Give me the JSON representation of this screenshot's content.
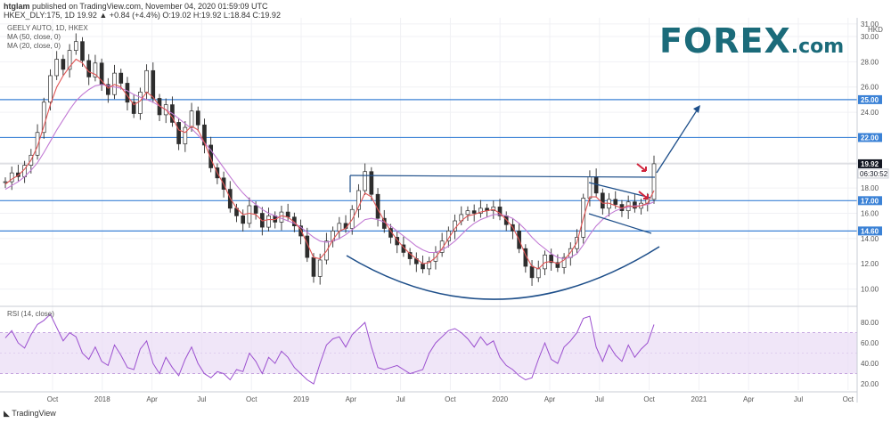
{
  "header": {
    "publisher": "htglam",
    "published_text": "published on TradingView.com, November 04, 2020 01:59:09 UTC",
    "symbol_line": "HKEX_DLY:175, 1D  19.92  ▲ +0.84 (+4.4%)  O:19.02  H:19.92  L:18.84  C:19.92"
  },
  "logo": {
    "text": "FOREX",
    "suffix": ".com",
    "color": "#1b6b7a"
  },
  "footer": {
    "brand": "TradingView"
  },
  "colors": {
    "candle": "#2d2d2d",
    "ma50": "#c27ad4",
    "ma20": "#e05555",
    "level": "#3b82d6",
    "trend": "#1e4f8a",
    "rsi": "#9b4fcf",
    "rsi_band": "#e9dcf5",
    "arrow_red": "#d0233b"
  },
  "chart_data": [
    {
      "type": "candlestick",
      "title": "GEELY AUTO, 1D, HKEX",
      "legend": [
        "MA (50, close, 0)",
        "MA (20, close, 0)"
      ],
      "currency": "HKD",
      "x_axis_labels": [
        "Oct",
        "2018",
        "Apr",
        "Jul",
        "Oct",
        "2019",
        "Apr",
        "Jul",
        "Oct",
        "2020",
        "Apr",
        "Jul",
        "Oct",
        "2021",
        "Apr",
        "Jul",
        "Oct"
      ],
      "y_ticks": [
        10.0,
        12.0,
        14.0,
        16.0,
        18.0,
        20.0,
        22.0,
        24.0,
        26.0,
        28.0,
        30.0,
        31.0
      ],
      "ylim": [
        8.7,
        31.2
      ],
      "horizontal_levels": [
        25.0,
        22.0,
        17.0,
        14.6
      ],
      "last_price": 19.92,
      "countdown": "06:30:52",
      "close_series": [
        18.5,
        19.2,
        18.9,
        19.8,
        20.6,
        22.4,
        24.8,
        26.9,
        28.2,
        27.4,
        28.9,
        29.6,
        28.1,
        26.8,
        27.9,
        26.2,
        25.4,
        27.1,
        26.3,
        24.8,
        23.9,
        25.6,
        27.3,
        25.1,
        23.8,
        24.6,
        23.2,
        21.5,
        22.8,
        24.1,
        23.0,
        21.4,
        19.6,
        18.8,
        17.9,
        16.4,
        15.8,
        15.2,
        16.6,
        16.0,
        14.9,
        15.8,
        15.3,
        16.1,
        15.7,
        15.0,
        14.2,
        12.5,
        11.0,
        12.3,
        13.8,
        14.6,
        15.2,
        14.8,
        16.3,
        17.8,
        19.3,
        17.5,
        15.6,
        14.8,
        14.1,
        13.5,
        12.9,
        12.4,
        12.0,
        11.6,
        12.2,
        12.9,
        13.8,
        14.6,
        15.4,
        15.9,
        16.2,
        16.0,
        16.4,
        16.2,
        16.5,
        15.8,
        15.1,
        14.6,
        13.2,
        11.8,
        10.9,
        11.6,
        12.7,
        12.1,
        11.7,
        12.5,
        13.2,
        14.1,
        17.2,
        18.9,
        17.6,
        16.4,
        17.1,
        16.7,
        16.2,
        16.9,
        16.4,
        16.8,
        17.1,
        19.92
      ],
      "series": [
        {
          "name": "MA (50, close, 0)",
          "values": [
            17.9,
            18.2,
            18.5,
            18.9,
            19.4,
            20.0,
            20.8,
            21.7,
            22.6,
            23.4,
            24.2,
            24.9,
            25.4,
            25.8,
            26.1,
            26.2,
            26.1,
            26.0,
            25.9,
            25.7,
            25.4,
            25.2,
            25.0,
            24.8,
            24.5,
            24.2,
            23.9,
            23.5,
            23.1,
            22.7,
            22.2,
            21.6,
            21.0,
            20.3,
            19.6,
            18.9,
            18.2,
            17.6,
            17.1,
            16.7,
            16.3,
            16.0,
            15.8,
            15.6,
            15.4,
            15.2,
            14.9,
            14.5,
            14.1,
            13.8,
            13.7,
            13.8,
            14.0,
            14.3,
            14.7,
            15.1,
            15.5,
            15.6,
            15.5,
            15.3,
            15.0,
            14.6,
            14.2,
            13.8,
            13.4,
            13.1,
            12.9,
            12.9,
            13.1,
            13.4,
            13.8,
            14.3,
            14.8,
            15.2,
            15.5,
            15.7,
            15.9,
            15.9,
            15.8,
            15.6,
            15.2,
            14.7,
            14.1,
            13.6,
            13.2,
            12.8,
            12.5,
            12.4,
            12.5,
            12.8,
            13.5,
            14.3,
            15.0,
            15.5,
            15.9,
            16.2,
            16.4,
            16.5,
            16.6,
            16.6,
            16.7,
            16.9
          ]
        },
        {
          "name": "MA (20, close, 0)",
          "values": [
            18.3,
            18.7,
            19.0,
            19.5,
            20.2,
            21.3,
            22.9,
            24.6,
            26.0,
            26.9,
            27.6,
            28.2,
            27.9,
            27.2,
            27.0,
            26.5,
            25.9,
            26.2,
            26.0,
            25.3,
            24.6,
            24.9,
            25.6,
            25.2,
            24.5,
            24.2,
            23.6,
            22.6,
            22.4,
            22.9,
            22.6,
            21.6,
            20.3,
            19.2,
            18.3,
            17.2,
            16.4,
            15.9,
            16.0,
            15.9,
            15.4,
            15.5,
            15.5,
            15.8,
            15.7,
            15.3,
            14.7,
            13.6,
            12.5,
            12.4,
            13.0,
            13.9,
            14.6,
            14.8,
            15.5,
            16.5,
            17.6,
            17.3,
            16.3,
            15.4,
            14.6,
            13.9,
            13.3,
            12.8,
            12.4,
            12.0,
            12.1,
            12.5,
            13.2,
            14.0,
            14.8,
            15.4,
            15.8,
            15.9,
            16.1,
            16.2,
            16.3,
            16.0,
            15.5,
            14.9,
            13.9,
            12.7,
            11.8,
            11.6,
            12.1,
            12.2,
            12.0,
            12.3,
            12.9,
            13.7,
            15.6,
            17.3,
            17.3,
            16.8,
            16.8,
            16.6,
            16.4,
            16.6,
            16.5,
            16.6,
            16.8,
            17.8
          ]
        }
      ]
    },
    {
      "type": "line",
      "title": "RSI (14, close)",
      "y_ticks": [
        20.0,
        40.0,
        60.0,
        80.0
      ],
      "ylim": [
        14,
        94
      ],
      "band": [
        30,
        70
      ],
      "values": [
        65,
        72,
        60,
        55,
        68,
        78,
        82,
        88,
        75,
        62,
        70,
        66,
        50,
        44,
        56,
        42,
        38,
        58,
        48,
        36,
        34,
        54,
        62,
        40,
        30,
        46,
        36,
        28,
        44,
        56,
        40,
        30,
        26,
        32,
        30,
        24,
        34,
        32,
        50,
        42,
        30,
        46,
        40,
        52,
        46,
        36,
        30,
        24,
        20,
        40,
        58,
        64,
        66,
        56,
        68,
        74,
        80,
        56,
        36,
        34,
        36,
        38,
        34,
        30,
        32,
        34,
        50,
        60,
        66,
        72,
        74,
        70,
        64,
        56,
        66,
        58,
        62,
        46,
        38,
        34,
        28,
        24,
        26,
        44,
        60,
        44,
        40,
        56,
        62,
        70,
        84,
        86,
        56,
        42,
        58,
        48,
        42,
        58,
        46,
        54,
        60,
        78
      ]
    }
  ]
}
